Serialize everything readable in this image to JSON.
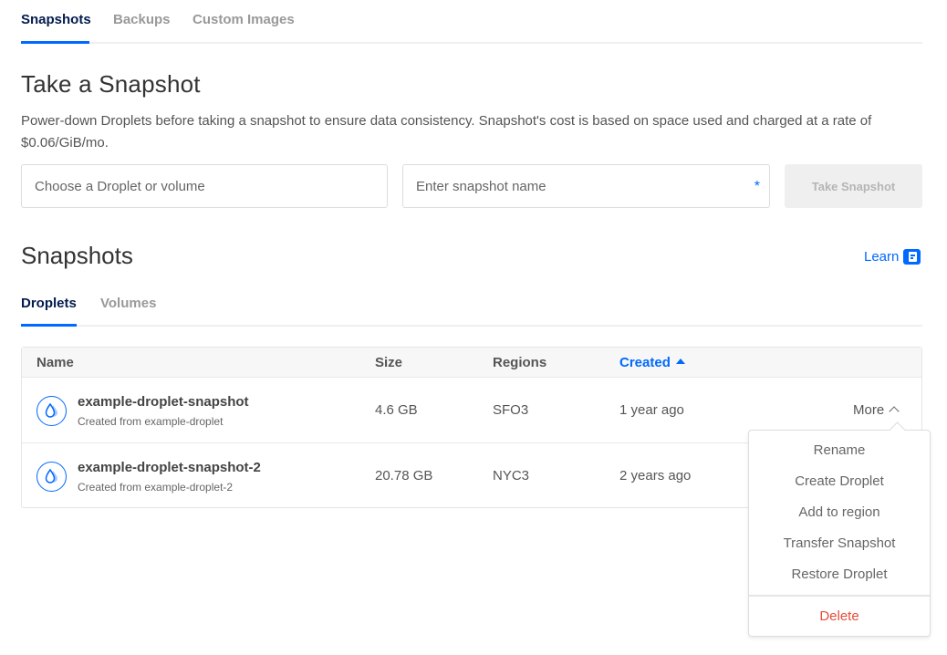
{
  "top_tabs": [
    {
      "label": "Snapshots",
      "active": true
    },
    {
      "label": "Backups",
      "active": false
    },
    {
      "label": "Custom Images",
      "active": false
    }
  ],
  "take_snapshot": {
    "title": "Take a Snapshot",
    "description": "Power-down Droplets before taking a snapshot to ensure data consistency. Snapshot's cost is based on space used and charged at a rate of $0.06/GiB/mo.",
    "source_placeholder": "Choose a Droplet or volume",
    "name_placeholder": "Enter snapshot name",
    "required_marker": "*",
    "button_label": "Take Snapshot"
  },
  "snapshots": {
    "title": "Snapshots",
    "learn_label": "Learn",
    "sub_tabs": [
      {
        "label": "Droplets",
        "active": true
      },
      {
        "label": "Volumes",
        "active": false
      }
    ],
    "columns": [
      "Name",
      "Size",
      "Regions",
      "Created"
    ],
    "sorted_column": "Created",
    "rows": [
      {
        "name": "example-droplet-snapshot",
        "source": "Created from example-droplet",
        "size": "4.6 GB",
        "region": "SFO3",
        "created": "1 year ago",
        "action": "More"
      },
      {
        "name": "example-droplet-snapshot-2",
        "source": "Created from example-droplet-2",
        "size": "20.78 GB",
        "region": "NYC3",
        "created": "2 years ago"
      }
    ]
  },
  "more_menu": {
    "items": [
      "Rename",
      "Create Droplet",
      "Add to region",
      "Transfer Snapshot",
      "Restore Droplet"
    ],
    "danger_item": "Delete"
  }
}
